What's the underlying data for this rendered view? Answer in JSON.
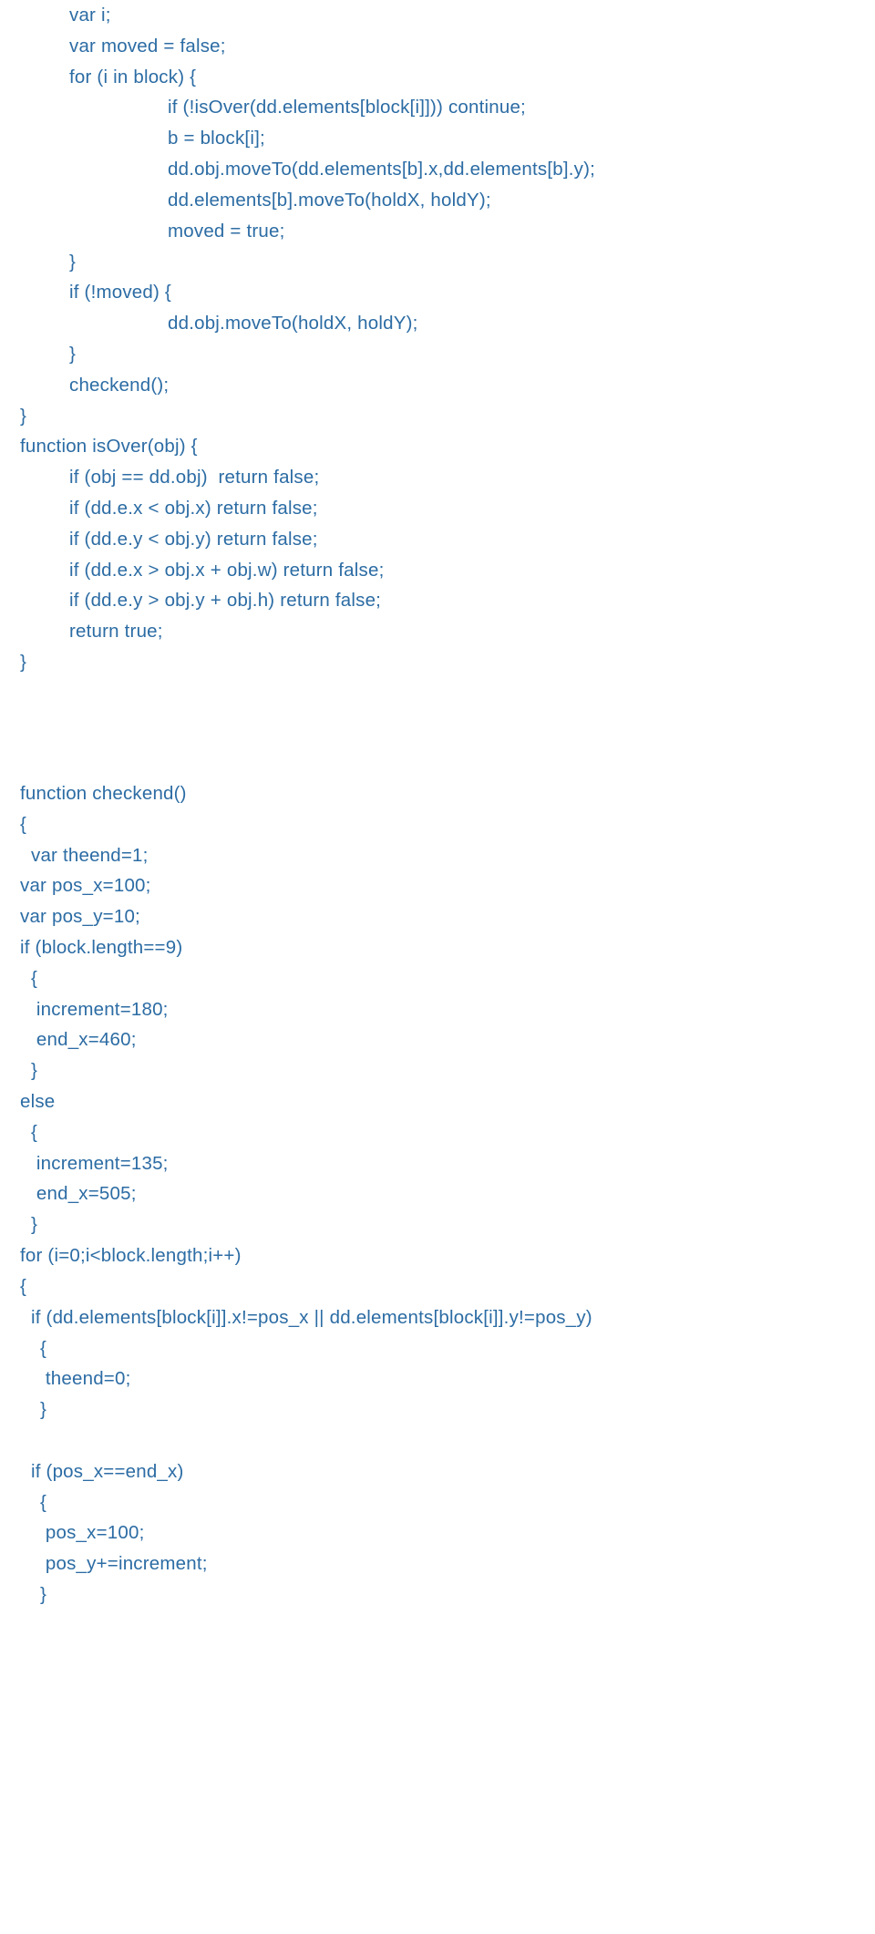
{
  "block1": {
    "lines": [
      {
        "cls": "ind1",
        "text": "var i;"
      },
      {
        "cls": "ind1",
        "text": "var moved = false;"
      },
      {
        "cls": "ind1",
        "text": "for (i in block) {"
      },
      {
        "cls": "ind3",
        "text": "if (!isOver(dd.elements[block[i]])) continue;"
      },
      {
        "cls": "ind3",
        "text": "b = block[i];"
      },
      {
        "cls": "ind3",
        "text": "dd.obj.moveTo(dd.elements[b].x,dd.elements[b].y);"
      },
      {
        "cls": "ind3",
        "text": "dd.elements[b].moveTo(holdX, holdY);"
      },
      {
        "cls": "ind3",
        "text": "moved = true;"
      },
      {
        "cls": "ind1",
        "text": "}"
      },
      {
        "cls": "ind1",
        "text": "if (!moved) {"
      },
      {
        "cls": "ind3",
        "text": "dd.obj.moveTo(holdX, holdY);"
      },
      {
        "cls": "ind1",
        "text": "}"
      },
      {
        "cls": "ind1",
        "text": "checkend();"
      },
      {
        "cls": "ind0",
        "text": "}"
      },
      {
        "cls": "ind0",
        "text": "function isOver(obj) {"
      },
      {
        "cls": "ind1",
        "text": "if (obj == dd.obj)  return false;"
      },
      {
        "cls": "ind1",
        "text": "if (dd.e.x < obj.x) return false;"
      },
      {
        "cls": "ind1",
        "text": "if (dd.e.y < obj.y) return false;"
      },
      {
        "cls": "ind1",
        "text": "if (dd.e.x > obj.x + obj.w) return false;"
      },
      {
        "cls": "ind1",
        "text": "if (dd.e.y > obj.y + obj.h) return false;"
      },
      {
        "cls": "ind1",
        "text": "return true;"
      },
      {
        "cls": "ind0",
        "text": "}"
      }
    ]
  },
  "block2": {
    "lines": [
      {
        "cls": "ind0",
        "text": "function checkend()"
      },
      {
        "cls": "ind0",
        "text": "{"
      },
      {
        "cls": "ind1",
        "text": "var theend=1;"
      },
      {
        "cls": "ind0",
        "text": "var pos_x=100;"
      },
      {
        "cls": "ind0",
        "text": "var pos_y=10;"
      },
      {
        "cls": "ind0",
        "text": "if (block.length==9)"
      },
      {
        "cls": "ind1",
        "text": "{"
      },
      {
        "cls": "ind1",
        "text": " increment=180;"
      },
      {
        "cls": "ind1",
        "text": " end_x=460;"
      },
      {
        "cls": "ind1",
        "text": "}"
      },
      {
        "cls": "ind0",
        "text": "else"
      },
      {
        "cls": "ind1",
        "text": "{"
      },
      {
        "cls": "ind1",
        "text": " increment=135;"
      },
      {
        "cls": "ind1",
        "text": " end_x=505;"
      },
      {
        "cls": "ind1",
        "text": "}"
      },
      {
        "cls": "ind0",
        "text": "for (i=0;i<block.length;i++)"
      },
      {
        "cls": "ind0",
        "text": "{"
      },
      {
        "cls": "ind1",
        "text": "if (dd.elements[block[i]].x!=pos_x || dd.elements[block[i]].y!=pos_y)"
      },
      {
        "cls": "ind2",
        "text": "{"
      },
      {
        "cls": "ind2",
        "text": " theend=0;"
      },
      {
        "cls": "ind2",
        "text": "}"
      },
      {
        "cls": "ind0",
        "text": " "
      },
      {
        "cls": "ind1",
        "text": "if (pos_x==end_x)"
      },
      {
        "cls": "ind2",
        "text": "{"
      },
      {
        "cls": "ind2",
        "text": " pos_x=100;"
      },
      {
        "cls": "ind2",
        "text": " pos_y+=increment;"
      },
      {
        "cls": "ind2",
        "text": "}"
      }
    ]
  }
}
